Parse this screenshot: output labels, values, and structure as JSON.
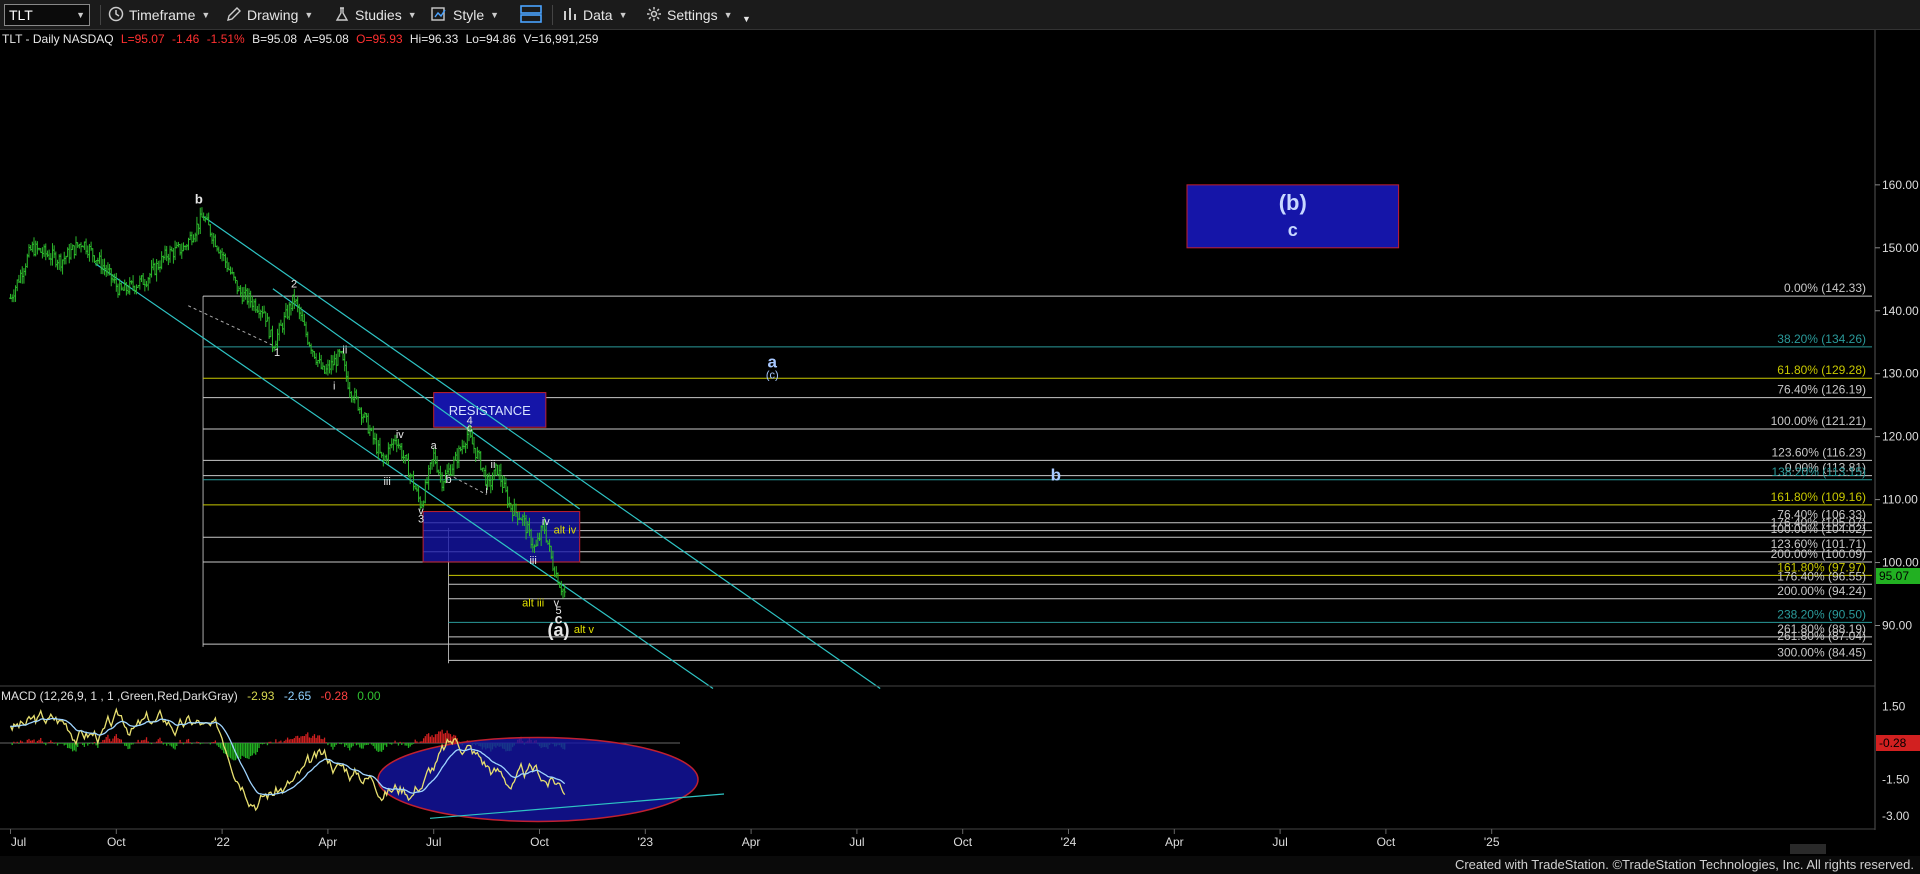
{
  "toolbar": {
    "symbol": "TLT",
    "timeframe": "Timeframe",
    "drawing": "Drawing",
    "studies": "Studies",
    "style": "Style",
    "data": "Data",
    "settings": "Settings"
  },
  "header": {
    "name": "TLT - Daily  NASDAQ",
    "last": "L=95.07",
    "change": "-1.46",
    "change_pct": "-1.51%",
    "bid": "B=95.08",
    "ask": "A=95.08",
    "open": "O=95.93",
    "high": "Hi=96.33",
    "low": "Lo=94.86",
    "volume": "V=16,991,259"
  },
  "macd": {
    "label": "MACD (12,26,9, 1 , 1 ,Green,Red,DarkGray)",
    "v1": "-2.93",
    "v2": "-2.65",
    "v3": "-0.28",
    "v4": "0.00",
    "axis": [
      "1.50",
      "-1.50",
      "-3.00"
    ],
    "last_tag": "-0.28"
  },
  "footer": "Created with TradeStation. ©TradeStation Technologies, Inc. All rights reserved.",
  "colors": {
    "up": "#22b022",
    "down": "#d22020",
    "channel": "#2ec4c4",
    "box_fill": "#1515a8",
    "box_border": "#c02030",
    "fib_white": "#c8c8c8",
    "fib_yellow": "#d4d400",
    "label_blue": "#a8c8ff"
  },
  "chart_data": {
    "type": "candlestick",
    "symbol": "TLT",
    "interval": "Daily",
    "last_price": 95.07,
    "price_axis": {
      "ticks": [
        160,
        150,
        140,
        130,
        120,
        110,
        100,
        90
      ],
      "labels": [
        "160.00",
        "150.00",
        "140.00",
        "130.00",
        "120.00",
        "110.00",
        "100.00",
        "90.00"
      ]
    },
    "time_axis": [
      "Jul",
      "Oct",
      "'22",
      "Apr",
      "Jul",
      "Oct",
      "'23",
      "Apr",
      "Jul",
      "Oct",
      "'24",
      "Apr",
      "Jul",
      "Oct",
      "'25"
    ],
    "price_path": [
      {
        "t": 2021.5,
        "p": 142
      },
      {
        "t": 2021.55,
        "p": 150
      },
      {
        "t": 2021.62,
        "p": 148
      },
      {
        "t": 2021.67,
        "p": 151
      },
      {
        "t": 2021.72,
        "p": 147
      },
      {
        "t": 2021.76,
        "p": 143
      },
      {
        "t": 2021.82,
        "p": 145
      },
      {
        "t": 2021.87,
        "p": 149
      },
      {
        "t": 2021.91,
        "p": 150
      },
      {
        "t": 2021.955,
        "p": 155
      },
      {
        "t": 2022.0,
        "p": 149
      },
      {
        "t": 2022.04,
        "p": 143
      },
      {
        "t": 2022.1,
        "p": 140
      },
      {
        "t": 2022.12,
        "p": 134.5
      },
      {
        "t": 2022.17,
        "p": 142
      },
      {
        "t": 2022.2,
        "p": 136
      },
      {
        "t": 2022.24,
        "p": 130
      },
      {
        "t": 2022.28,
        "p": 133
      },
      {
        "t": 2022.3,
        "p": 128
      },
      {
        "t": 2022.33,
        "p": 124
      },
      {
        "t": 2022.38,
        "p": 116
      },
      {
        "t": 2022.41,
        "p": 120
      },
      {
        "t": 2022.45,
        "p": 113
      },
      {
        "t": 2022.47,
        "p": 109
      },
      {
        "t": 2022.5,
        "p": 117
      },
      {
        "t": 2022.52,
        "p": 113
      },
      {
        "t": 2022.55,
        "p": 116
      },
      {
        "t": 2022.58,
        "p": 120.5
      },
      {
        "t": 2022.61,
        "p": 116
      },
      {
        "t": 2022.63,
        "p": 112
      },
      {
        "t": 2022.65,
        "p": 115
      },
      {
        "t": 2022.68,
        "p": 109
      },
      {
        "t": 2022.71,
        "p": 107
      },
      {
        "t": 2022.74,
        "p": 102
      },
      {
        "t": 2022.76,
        "p": 106
      },
      {
        "t": 2022.78,
        "p": 100
      },
      {
        "t": 2022.8,
        "p": 96.3
      },
      {
        "t": 2022.81,
        "p": 95.07
      }
    ],
    "fib_levels": [
      {
        "label": "0.00% (142.33)",
        "value": 142.33,
        "color": "white"
      },
      {
        "label": "38.20% (134.26)",
        "value": 134.26,
        "color": "teal"
      },
      {
        "label": "61.80% (129.28)",
        "value": 129.28,
        "color": "yellow"
      },
      {
        "label": "76.40% (126.19)",
        "value": 126.19,
        "color": "white"
      },
      {
        "label": "100.00% (121.21)",
        "value": 121.21,
        "color": "white"
      },
      {
        "label": "123.60% (116.23)",
        "value": 116.23,
        "color": "white"
      },
      {
        "label": "0.00% (113.81)",
        "value": 113.81,
        "color": "white"
      },
      {
        "label": "138.20% (113.15)",
        "value": 113.15,
        "color": "teal"
      },
      {
        "label": "161.80% (109.16)",
        "value": 109.16,
        "color": "yellow"
      },
      {
        "label": "76.40% (106.33)",
        "value": 106.33,
        "color": "white"
      },
      {
        "label": "176.40% (105.07)",
        "value": 105.07,
        "color": "white"
      },
      {
        "label": "100.00% (104.02)",
        "value": 104.02,
        "color": "white"
      },
      {
        "label": "123.60% (101.71)",
        "value": 101.71,
        "color": "white"
      },
      {
        "label": "200.00% (100.09)",
        "value": 100.09,
        "color": "white"
      },
      {
        "label": "161.80% (97.97)",
        "value": 97.97,
        "color": "yellow"
      },
      {
        "label": "176.40% (96.55)",
        "value": 96.55,
        "color": "white"
      },
      {
        "label": "200.00% (94.24)",
        "value": 94.24,
        "color": "white"
      },
      {
        "label": "238.20% (90.50)",
        "value": 90.5,
        "color": "teal"
      },
      {
        "label": "261.80% (88.19)",
        "value": 88.19,
        "color": "white"
      },
      {
        "label": "261.80% (87.04)",
        "value": 87.04,
        "color": "white"
      },
      {
        "label": "300.00% (84.45)",
        "value": 84.45,
        "color": "white"
      }
    ],
    "boxes": [
      {
        "name": "target-box-b",
        "t0": 2024.28,
        "t1": 2024.78,
        "p0": 150,
        "p1": 160,
        "labels": [
          "(b)",
          "c"
        ]
      },
      {
        "name": "resistance-box",
        "t0": 2022.5,
        "t1": 2022.765,
        "p0": 121.5,
        "p1": 127,
        "labels": [
          "RESISTANCE"
        ]
      },
      {
        "name": "support-box",
        "t0": 2022.475,
        "t1": 2022.845,
        "p0": 100.1,
        "p1": 108.1,
        "labels": []
      }
    ],
    "channel_lines": [
      {
        "t0": 2021.955,
        "p0": 155,
        "t1": 2023.555,
        "p1": 80
      },
      {
        "t0": 2021.7,
        "p0": 147.5,
        "t1": 2023.16,
        "p1": 80
      },
      {
        "t0": 2022.12,
        "p0": 143.5,
        "t1": 2022.845,
        "p1": 108.5
      }
    ],
    "wave_labels": [
      {
        "text": "b",
        "t": 2021.945,
        "p": 157,
        "color": "white",
        "size": 13
      },
      {
        "text": "2",
        "t": 2022.17,
        "p": 143.7,
        "color": "white",
        "size": 11
      },
      {
        "text": "1",
        "t": 2022.13,
        "p": 132.8,
        "color": "white",
        "size": 11
      },
      {
        "text": "ii",
        "t": 2022.29,
        "p": 133.2,
        "color": "white",
        "size": 11
      },
      {
        "text": "i",
        "t": 2022.265,
        "p": 127.5,
        "color": "white",
        "size": 11
      },
      {
        "text": "iv",
        "t": 2022.42,
        "p": 119.8,
        "color": "white",
        "size": 11
      },
      {
        "text": "iii",
        "t": 2022.39,
        "p": 112.3,
        "color": "white",
        "size": 11
      },
      {
        "text": "v",
        "t": 2022.47,
        "p": 107.6,
        "color": "white",
        "size": 11
      },
      {
        "text": "3",
        "t": 2022.47,
        "p": 106.4,
        "color": "white",
        "size": 11
      },
      {
        "text": "a",
        "t": 2022.5,
        "p": 118.0,
        "color": "white",
        "size": 11
      },
      {
        "text": "b",
        "t": 2022.535,
        "p": 112.6,
        "color": "white",
        "size": 11
      },
      {
        "text": "4",
        "t": 2022.585,
        "p": 122.0,
        "color": "white",
        "size": 11
      },
      {
        "text": "c",
        "t": 2022.585,
        "p": 120.8,
        "color": "white",
        "size": 11
      },
      {
        "text": "ii",
        "t": 2022.64,
        "p": 115.0,
        "color": "white",
        "size": 11
      },
      {
        "text": "i",
        "t": 2022.625,
        "p": 111.0,
        "color": "white",
        "size": 11
      },
      {
        "text": "iv",
        "t": 2022.765,
        "p": 106.0,
        "color": "white",
        "size": 11
      },
      {
        "text": "alt iv",
        "t": 2022.81,
        "p": 104.6,
        "color": "yellow",
        "size": 11
      },
      {
        "text": "iii",
        "t": 2022.735,
        "p": 99.8,
        "color": "white",
        "size": 11
      },
      {
        "text": "alt iii",
        "t": 2022.735,
        "p": 93.0,
        "color": "yellow",
        "size": 11
      },
      {
        "text": "v",
        "t": 2022.79,
        "p": 93.0,
        "color": "white",
        "size": 11
      },
      {
        "text": "5",
        "t": 2022.795,
        "p": 91.8,
        "color": "white",
        "size": 11
      },
      {
        "text": "c",
        "t": 2022.795,
        "p": 90.3,
        "color": "white",
        "size": 14
      },
      {
        "text": "(a)",
        "t": 2022.795,
        "p": 88.3,
        "color": "white",
        "size": 18
      },
      {
        "text": "alt v",
        "t": 2022.855,
        "p": 88.8,
        "color": "yellow",
        "size": 11
      },
      {
        "text": "a",
        "t": 2023.3,
        "p": 131.0,
        "color": "blue",
        "size": 17
      },
      {
        "text": "(c)",
        "t": 2023.3,
        "p": 129.2,
        "color": "blue",
        "size": 11
      },
      {
        "text": "b",
        "t": 2023.97,
        "p": 113.0,
        "color": "blue",
        "size": 17
      }
    ],
    "macd_axis": {
      "ticks": [
        1.5,
        -1.5,
        -3.0
      ]
    },
    "annotations": [
      "bullish divergence ellipse on MACD"
    ]
  }
}
